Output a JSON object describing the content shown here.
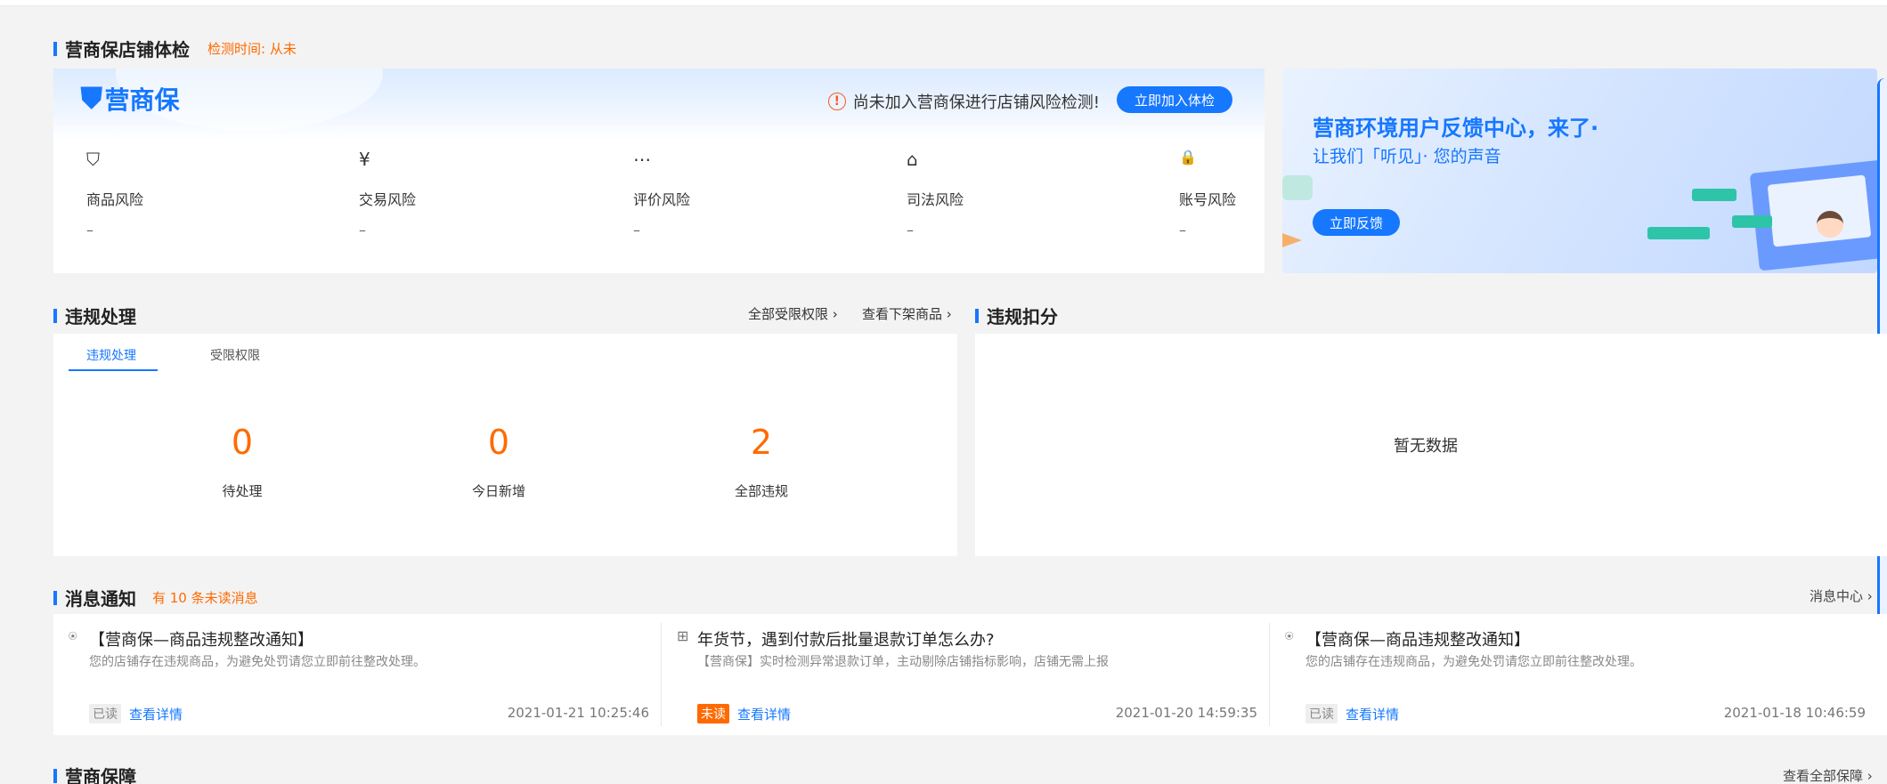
{
  "store_check": {
    "title": "营商保店铺体检",
    "check_time": "检测时间: 从未",
    "logo_name": "营商保",
    "warning": "尚未加入营商保进行店铺风险检测!",
    "join_button": "立即加入体检",
    "risks": [
      {
        "icon": "bag-icon",
        "glyph": "⛉",
        "label": "商品风险",
        "value": "–"
      },
      {
        "icon": "yen-icon",
        "glyph": "¥",
        "label": "交易风险",
        "value": "–"
      },
      {
        "icon": "chat-icon",
        "glyph": "⋯",
        "label": "评价风险",
        "value": "–"
      },
      {
        "icon": "court-icon",
        "glyph": "⌂",
        "label": "司法风险",
        "value": "–"
      },
      {
        "icon": "lock-icon",
        "glyph": "🔒",
        "label": "账号风险",
        "value": "–"
      }
    ]
  },
  "banner": {
    "headline": "营商环境用户反馈中心，来了·",
    "subline": "让我们「听见」· 您的声音",
    "button": "立即反馈"
  },
  "violation": {
    "title": "违规处理",
    "link_all_limits": "全部受限权限",
    "link_delisted": "查看下架商品",
    "tabs": [
      "违规处理",
      "受限权限"
    ],
    "stats": [
      {
        "value": "0",
        "label": "待处理"
      },
      {
        "value": "0",
        "label": "今日新增"
      },
      {
        "value": "2",
        "label": "全部违规"
      }
    ]
  },
  "deduction": {
    "title": "违规扣分",
    "empty": "暂无数据"
  },
  "messages": {
    "title": "消息通知",
    "unread_note": "有 10 条未读消息",
    "center_link": "消息中心",
    "items": [
      {
        "icon": "notice-icon",
        "glyph": "⍟",
        "title": "【营商保—商品违规整改通知】",
        "desc": "您的店铺存在违规商品，为避免处罚请您立即前往整改处理。",
        "status": "已读",
        "read": true,
        "detail": "查看详情",
        "time": "2021-01-21 10:25:46"
      },
      {
        "icon": "grid-icon",
        "glyph": "⊞",
        "title": "年货节，遇到付款后批量退款订单怎么办?",
        "desc": "【营商保】实时检测异常退款订单，主动剔除店铺指标影响，店铺无需上报",
        "status": "未读",
        "read": false,
        "detail": "查看详情",
        "time": "2021-01-20 14:59:35"
      },
      {
        "icon": "notice-icon",
        "glyph": "⍟",
        "title": "【营商保—商品违规整改通知】",
        "desc": "您的店铺存在违规商品，为避免处罚请您立即前往整改处理。",
        "status": "已读",
        "read": true,
        "detail": "查看详情",
        "time": "2021-01-18 10:46:59"
      }
    ]
  },
  "guarantee": {
    "title": "营商保障",
    "link": "查看全部保障"
  },
  "colors": {
    "accent": "#1677ff",
    "orange": "#ff6a00"
  }
}
